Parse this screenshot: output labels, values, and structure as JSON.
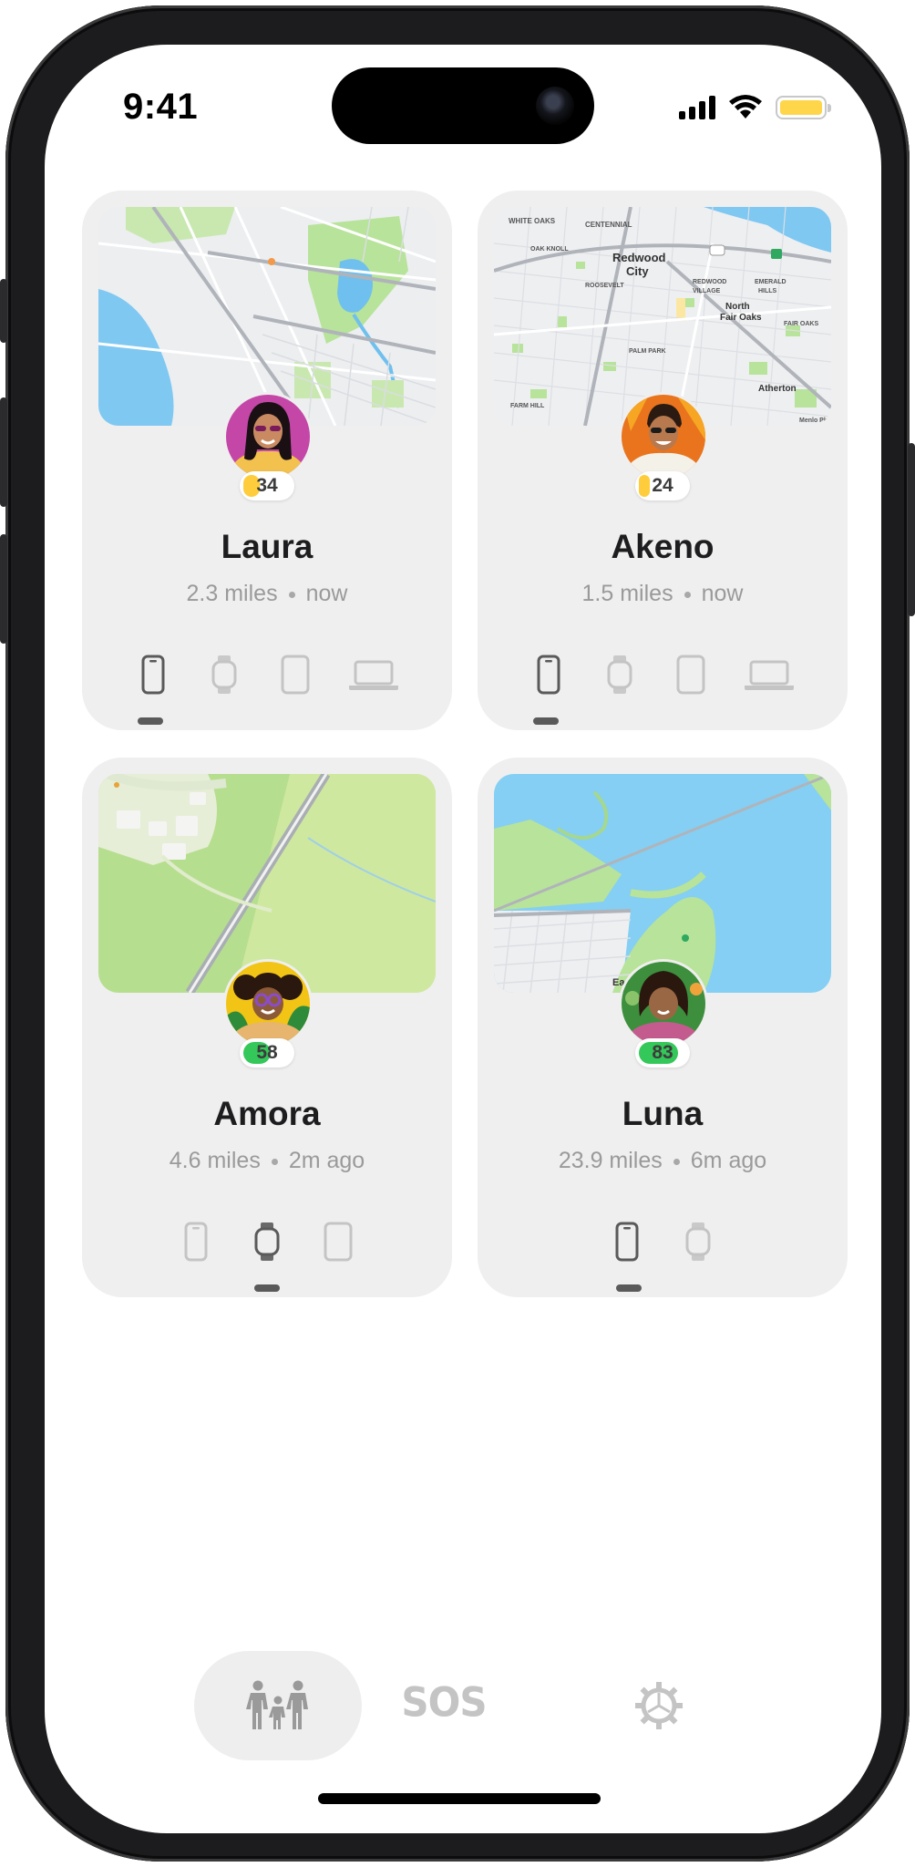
{
  "status_bar": {
    "time": "9:41"
  },
  "people": [
    {
      "name": "Laura",
      "distance": "2.3 miles",
      "updated": "now",
      "battery": "34",
      "battery_color": "#ffcc3b",
      "battery_level": 0.34,
      "devices": [
        "phone",
        "watch",
        "tablet",
        "laptop"
      ],
      "active_device": 0
    },
    {
      "name": "Akeno",
      "distance": "1.5 miles",
      "updated": "now",
      "battery": "24",
      "battery_color": "#ffcc3b",
      "battery_level": 0.24,
      "devices": [
        "phone",
        "watch",
        "tablet",
        "laptop"
      ],
      "active_device": 0
    },
    {
      "name": "Amora",
      "distance": "4.6 miles",
      "updated": "2m ago",
      "battery": "58",
      "battery_color": "#34c759",
      "battery_level": 0.58,
      "devices": [
        "phone",
        "watch",
        "tablet"
      ],
      "active_device": 1
    },
    {
      "name": "Luna",
      "distance": "23.9 miles",
      "updated": "6m ago",
      "battery": "83",
      "battery_color": "#34c759",
      "battery_level": 0.83,
      "devices": [
        "phone",
        "watch"
      ],
      "active_device": 0
    }
  ],
  "map_labels": {
    "akeno": [
      "WHITE OAKS",
      "CENTENNIAL",
      "Redwood",
      "City",
      "OAK KNOLL",
      "ROOSEVELT",
      "REDWOOD",
      "VILLAGE",
      "EMERALD",
      "HILLS",
      "North",
      "Fair Oaks",
      "FAIR OAKS",
      "PALM PARK",
      "FARM HILL",
      "Atherton",
      "Menlo Pk"
    ],
    "luna": [
      "East",
      "Pa"
    ]
  },
  "tabs": {
    "sos": "SOS"
  },
  "colors": {
    "battery_low": "#ffcc3b",
    "battery_ok": "#34c759",
    "active_device": "#5a5a5a",
    "inactive_device": "#c4c4c4"
  }
}
